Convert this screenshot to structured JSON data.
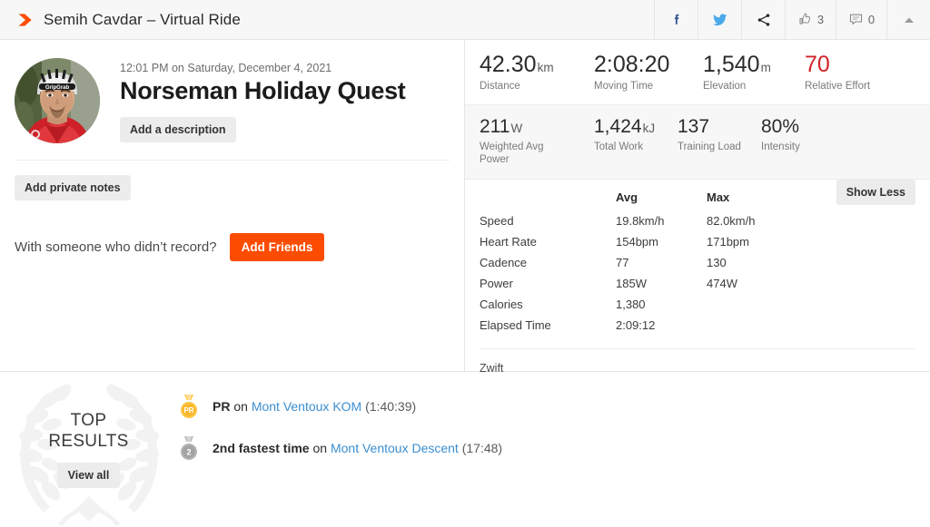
{
  "header": {
    "title": "Semih Cavdar – Virtual Ride",
    "logo_icon": "strava-chevron-icon",
    "actions": [
      {
        "name": "facebook-share-button",
        "icon": "facebook-icon",
        "count": ""
      },
      {
        "name": "twitter-share-button",
        "icon": "twitter-icon",
        "count": ""
      },
      {
        "name": "share-button",
        "icon": "share-icon",
        "count": ""
      },
      {
        "name": "kudos-button",
        "icon": "thumbs-up-icon",
        "count": "3"
      },
      {
        "name": "comments-button",
        "icon": "comment-icon",
        "count": "0"
      },
      {
        "name": "collapse-button",
        "icon": "caret-up-icon",
        "count": ""
      }
    ]
  },
  "activity": {
    "date": "12:01 PM on Saturday, December 4, 2021",
    "title": "Norseman Holiday Quest",
    "add_description_label": "Add a description",
    "add_private_notes_label": "Add private notes",
    "friends_prompt": "With someone who didn’t record?",
    "add_friends_label": "Add Friends",
    "avatar_alt": "athlete-avatar"
  },
  "stats": {
    "primary": [
      {
        "value": "42.30",
        "unit": "km",
        "label": "Distance",
        "highlight": false
      },
      {
        "value": "2:08:20",
        "unit": "",
        "label": "Moving Time",
        "highlight": false
      },
      {
        "value": "1,540",
        "unit": "m",
        "label": "Elevation",
        "highlight": false
      },
      {
        "value": "70",
        "unit": "",
        "label": "Relative Effort",
        "highlight": true
      }
    ],
    "secondary": [
      {
        "value": "211",
        "unit": "W",
        "label": "Weighted Avg Power"
      },
      {
        "value": "1,424",
        "unit": "kJ",
        "label": "Total Work"
      },
      {
        "value": "137",
        "unit": "",
        "label": "Training Load"
      },
      {
        "value": "80%",
        "unit": "",
        "label": "Intensity"
      }
    ],
    "table": {
      "columns": [
        "",
        "Avg",
        "Max"
      ],
      "rows": [
        {
          "label": "Speed",
          "avg": "19.8km/h",
          "max": "82.0km/h"
        },
        {
          "label": "Heart Rate",
          "avg": "154bpm",
          "max": "171bpm"
        },
        {
          "label": "Cadence",
          "avg": "77",
          "max": "130"
        },
        {
          "label": "Power",
          "avg": "185W",
          "max": "474W"
        },
        {
          "label": "Calories",
          "avg": "1,380",
          "max": ""
        },
        {
          "label": "Elapsed Time",
          "avg": "2:09:12",
          "max": ""
        }
      ]
    },
    "show_less_label": "Show Less",
    "device": "Zwift"
  },
  "top_results": {
    "title_line1": "TOP",
    "title_line2": "RESULTS",
    "view_all_label": "View all",
    "items": [
      {
        "medal": "pr-medal-icon",
        "medal_text": "PR",
        "medal_color": "#fcc644",
        "prefix": "PR",
        "connector": " on ",
        "segment": "Mont Ventoux KOM",
        "time": "(1:40:39)"
      },
      {
        "medal": "second-place-medal-icon",
        "medal_text": "2",
        "medal_color": "#aaaaaa",
        "prefix": "2nd fastest time",
        "connector": " on ",
        "segment": "Mont Ventoux Descent",
        "time": "(17:48)"
      }
    ]
  },
  "colors": {
    "brand_orange": "#fc4c02",
    "link_blue": "#3b8ed0",
    "effort_red": "#d1232a",
    "facebook_blue": "#3b5998",
    "twitter_blue": "#4aa9e8"
  }
}
